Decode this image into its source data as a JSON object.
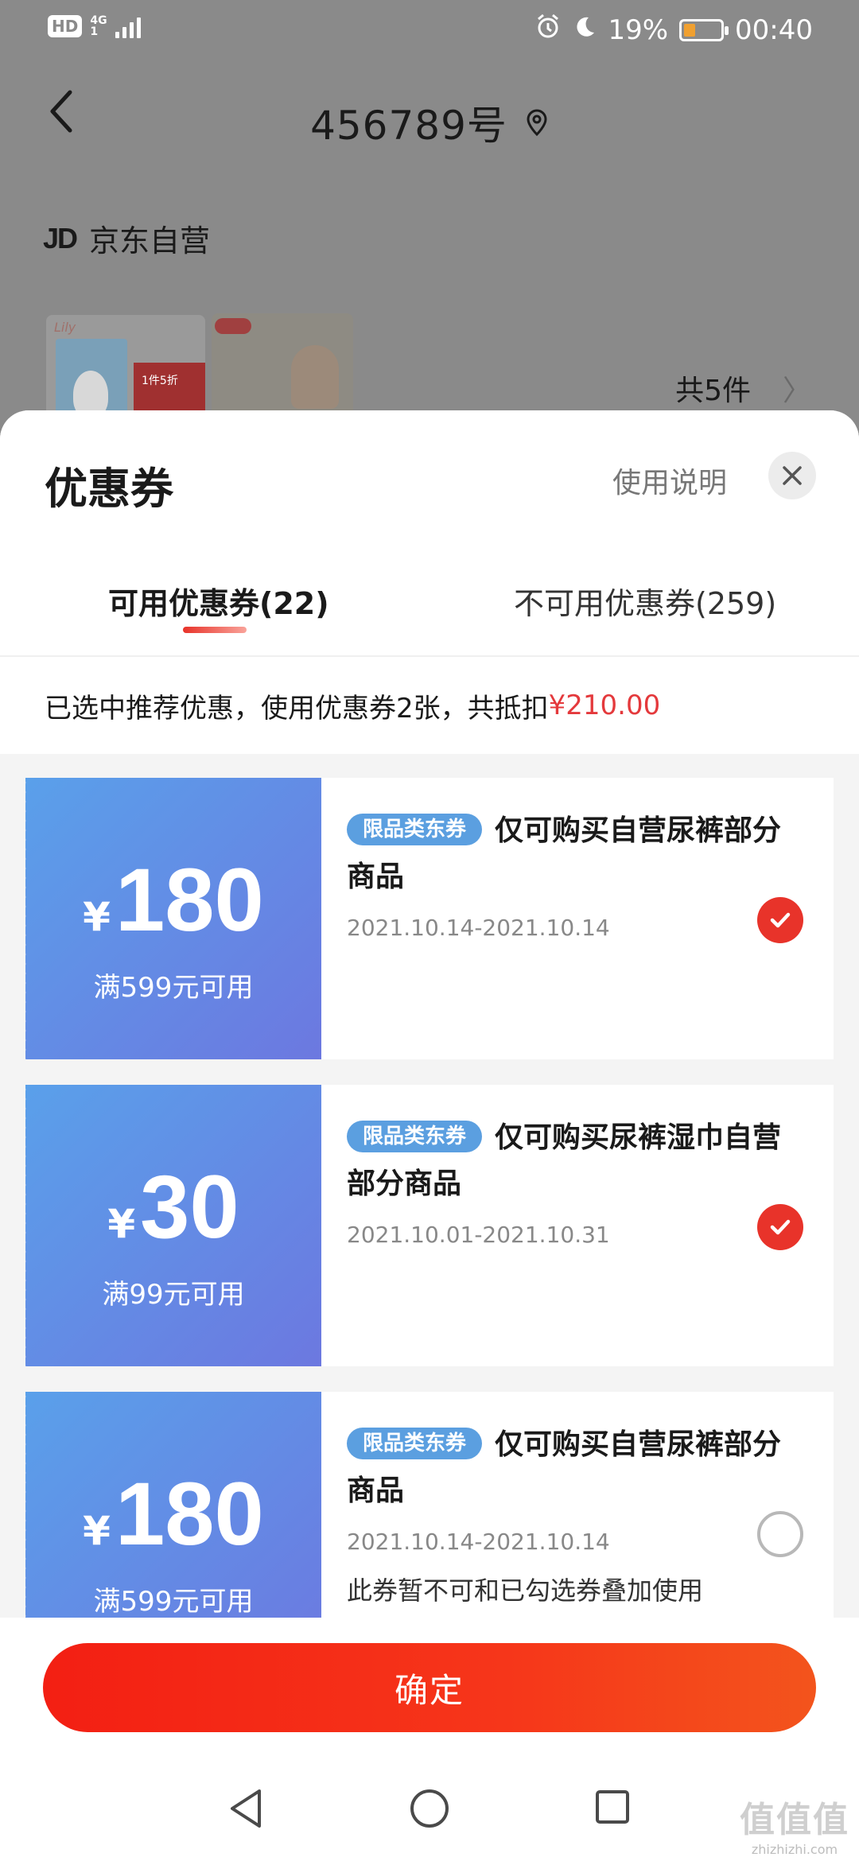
{
  "status_bar": {
    "hd": "HD",
    "net_top": "4G",
    "net_bottom": "1",
    "battery_percent": "19%",
    "time": "00:40"
  },
  "header": {
    "title": "456789号"
  },
  "shop": {
    "logo": "JD",
    "name": "京东自营"
  },
  "order": {
    "thumb_badge": "1件5折",
    "item_count": "共5件",
    "chevron": "〉"
  },
  "sheet": {
    "title": "优惠券",
    "help": "使用说明",
    "tabs": [
      {
        "label": "可用优惠券(22)",
        "active": true
      },
      {
        "label": "不可用优惠券(259)",
        "active": false
      }
    ],
    "summary_prefix": "已选中推荐优惠，使用优惠券2张，共抵扣",
    "summary_amount": "¥210.00"
  },
  "coupons": [
    {
      "yen": "¥",
      "amount": "180",
      "condition": "满599元可用",
      "tag": "限品类东券",
      "desc": "仅可购买自营尿裤部分商品",
      "date": "2021.10.14-2021.10.14",
      "note": "",
      "selected": true
    },
    {
      "yen": "¥",
      "amount": "30",
      "condition": "满99元可用",
      "tag": "限品类东券",
      "desc": "仅可购买尿裤湿巾自营部分商品",
      "date": "2021.10.01-2021.10.31",
      "note": "",
      "selected": true
    },
    {
      "yen": "¥",
      "amount": "180",
      "condition": "满599元可用",
      "tag": "限品类东券",
      "desc": "仅可购买自营尿裤部分商品",
      "date": "2021.10.14-2021.10.14",
      "note": "此券暂不可和已勾选券叠加使用",
      "selected": false
    }
  ],
  "footer": {
    "confirm": "确定"
  },
  "watermark": {
    "big": "值值值",
    "small": "zhizhizhi.com"
  },
  "colors": {
    "accent_red": "#e4393c",
    "coupon_blue": "#5aa0ea",
    "tag_blue": "#5b9fe0"
  },
  "icons": [
    "back-arrow-icon",
    "location-pin-icon",
    "close-icon",
    "check-icon",
    "alarm-icon",
    "moon-icon",
    "battery-icon",
    "signal-icon",
    "nav-back-icon",
    "nav-home-icon",
    "nav-recent-icon"
  ]
}
